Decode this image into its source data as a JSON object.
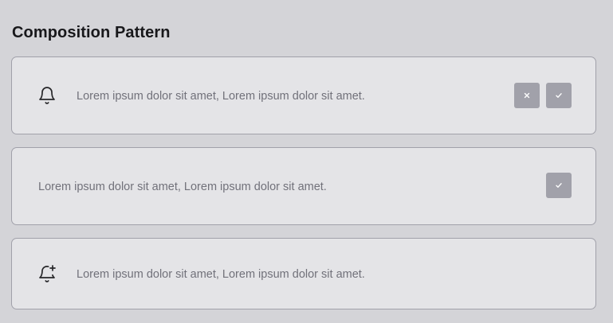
{
  "page": {
    "title": "Composition Pattern"
  },
  "notifications": [
    {
      "icon": "bell-icon",
      "text": "Lorem ipsum dolor sit amet, Lorem ipsum dolor sit amet.",
      "actions": [
        "dismiss",
        "accept"
      ]
    },
    {
      "icon": null,
      "text": "Lorem ipsum dolor sit amet, Lorem ipsum dolor sit amet.",
      "actions": [
        "accept"
      ]
    },
    {
      "icon": "bell-plus-icon",
      "text": "Lorem ipsum dolor sit amet, Lorem ipsum dolor sit amet.",
      "actions": []
    }
  ],
  "colors": {
    "background": "#d4d4d8",
    "card": "#e4e4e7",
    "card_border": "#a1a1aa",
    "button": "#a1a1aa",
    "text": "#71717a",
    "heading": "#18181b"
  }
}
